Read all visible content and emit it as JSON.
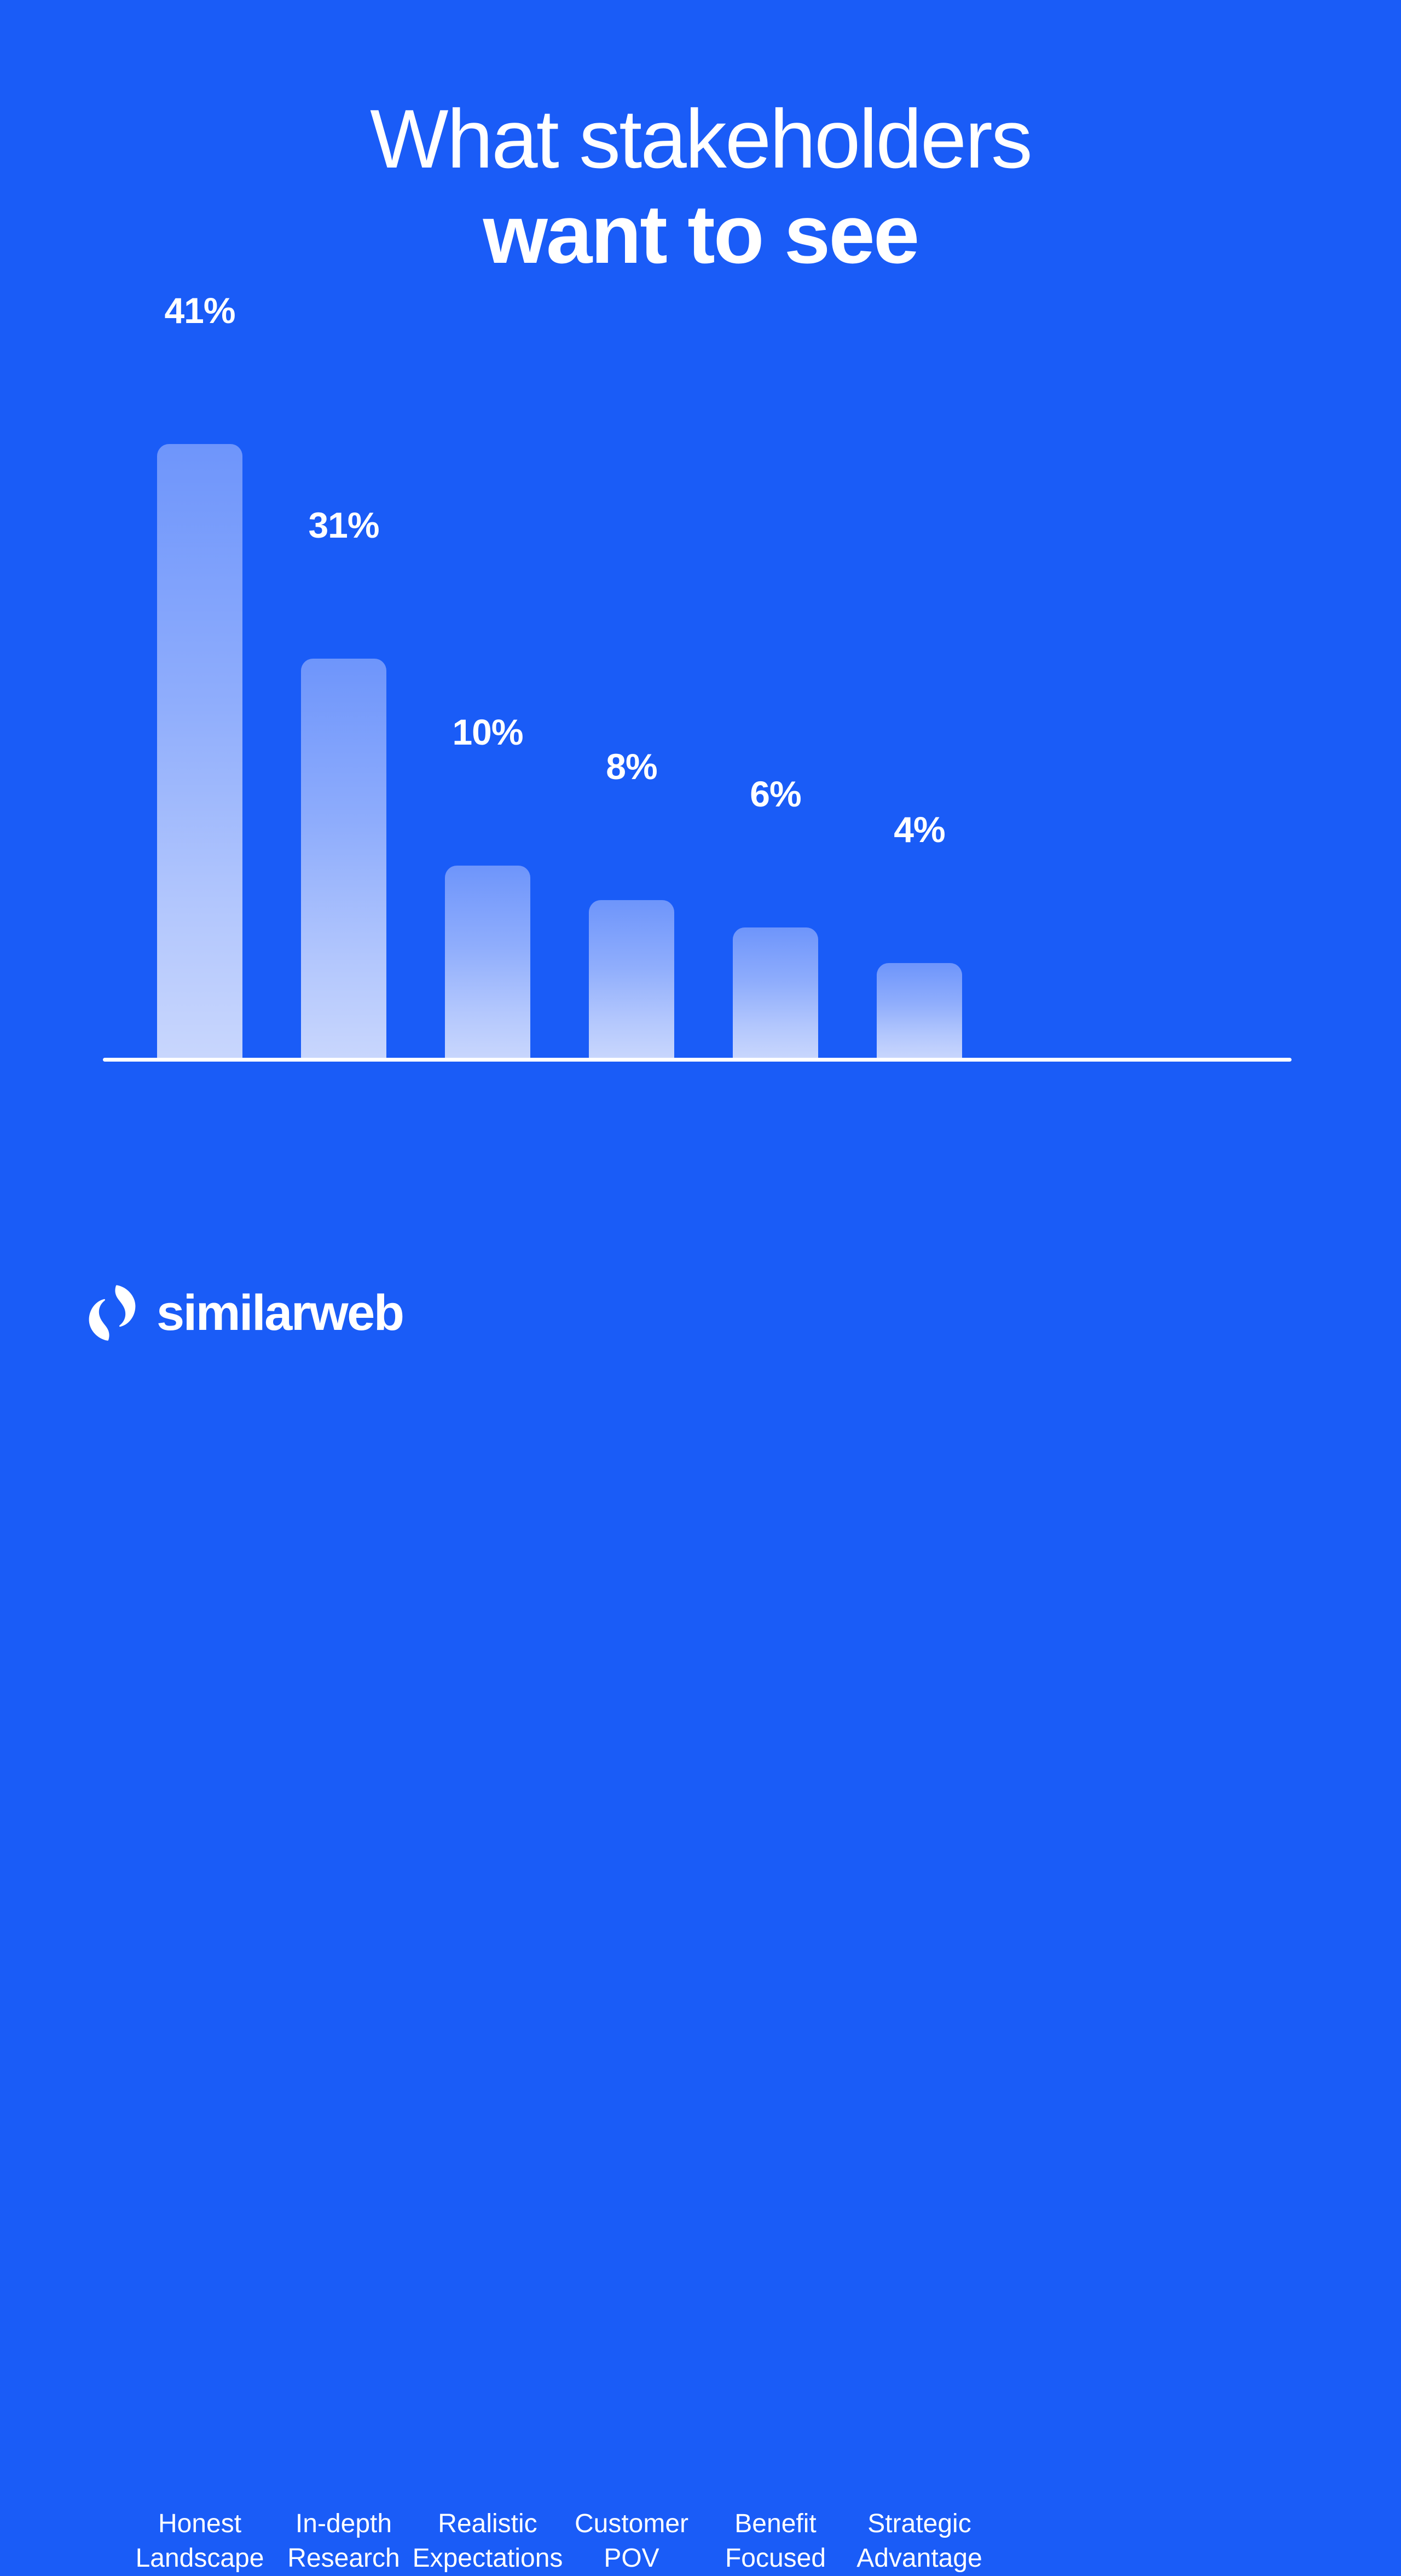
{
  "background_color": "#1a5cf7",
  "title": {
    "line1": "What stakeholders",
    "line2": "want to see"
  },
  "chart_data": {
    "type": "bar",
    "title": "What stakeholders want to see",
    "xlabel": "",
    "ylabel": "",
    "grid": false,
    "legend": "none",
    "axis_line": true,
    "unit": "%",
    "categories": [
      "Honest Landscape",
      "In-depth Research",
      "Realistic Expectations",
      "Customer POV",
      "Benefit Focused",
      "Strategic Advantage"
    ],
    "category_lines": [
      [
        "Honest",
        "Landscape"
      ],
      [
        "In-depth",
        "Research"
      ],
      [
        "Realistic",
        "Expectations"
      ],
      [
        "Customer",
        "POV"
      ],
      [
        "Benefit",
        "Focused"
      ],
      [
        "Strategic",
        "Advantage"
      ]
    ],
    "values": [
      41,
      31,
      10,
      8,
      6,
      4
    ],
    "value_labels": [
      "41%",
      "31%",
      "10%",
      "8%",
      "6%",
      "4%"
    ],
    "bar_pixel_heights": [
      1121,
      729,
      351,
      288,
      238,
      173
    ],
    "bar_colors": {
      "gradient_top": "#6e95fb",
      "gradient_bottom": "#c8d6fd"
    },
    "label_color": "#ffffff"
  },
  "logo": {
    "mark": "similarweb-swirl-icon",
    "text": "similarweb"
  }
}
